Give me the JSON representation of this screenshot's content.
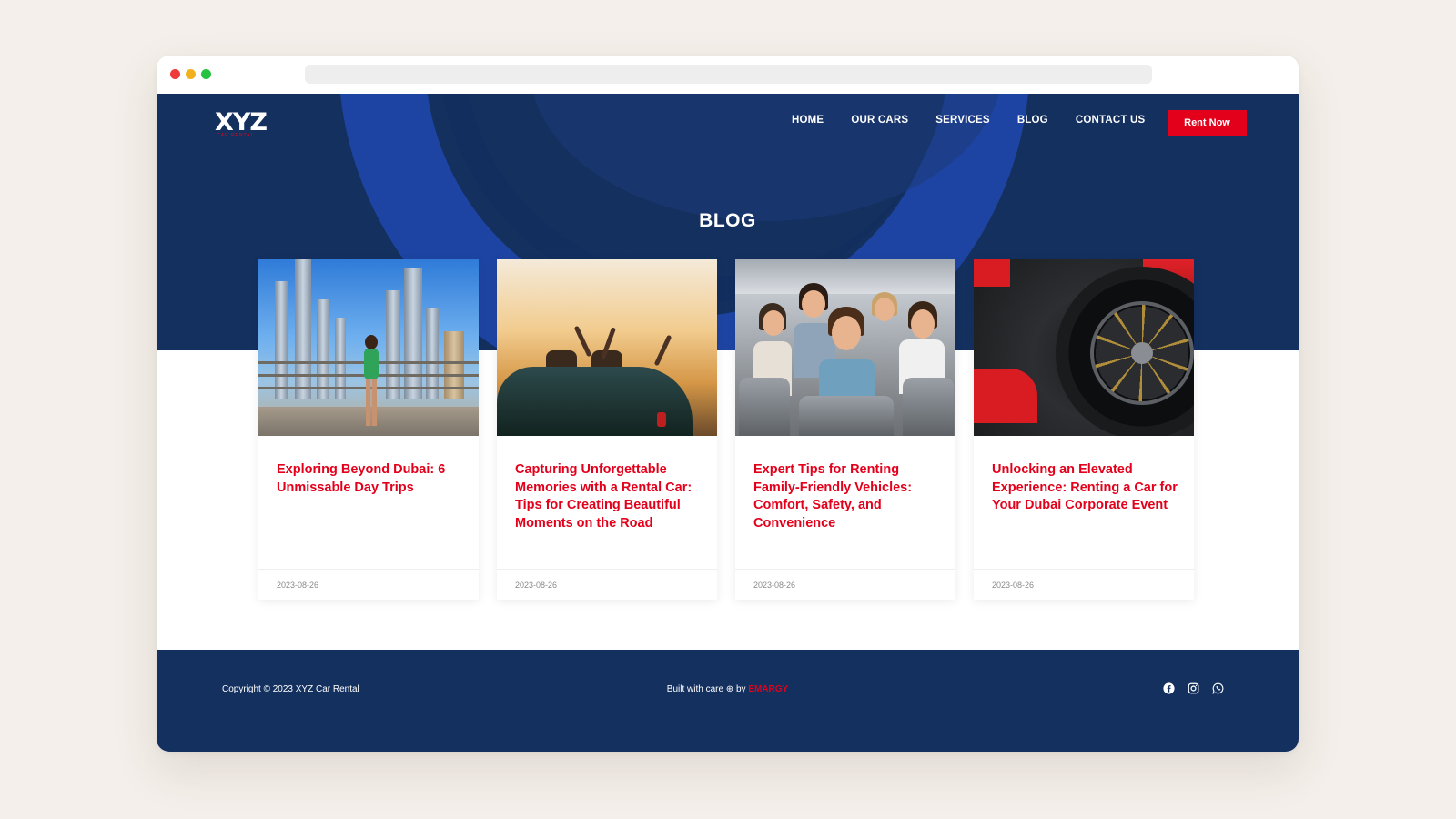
{
  "nav": {
    "logo_text": "XYZ",
    "logo_sub": "CAR RENTAL",
    "items": [
      {
        "label": "HOME"
      },
      {
        "label": "OUR CARS"
      },
      {
        "label": "SERVICES"
      },
      {
        "label": "BLOG"
      },
      {
        "label": "CONTACT US"
      }
    ],
    "cta_label": "Rent Now"
  },
  "page": {
    "title": "BLOG"
  },
  "posts": [
    {
      "title": "Exploring Beyond Dubai: 6 Unmissable Day Trips",
      "date": "2023-08-26",
      "image": "dubai-skyline-photo"
    },
    {
      "title": "Capturing Unforgettable Memories with a Rental Car: Tips for Creating Beautiful Moments on the Road",
      "date": "2023-08-26",
      "image": "convertible-sunset-photo"
    },
    {
      "title": "Expert Tips for Renting Family-Friendly Vehicles: Comfort, Safety, and Convenience",
      "date": "2023-08-26",
      "image": "family-in-car-photo"
    },
    {
      "title": "Unlocking an Elevated Experience: Renting a Car for Your Dubai Corporate Event",
      "date": "2023-08-26",
      "image": "sports-car-wheel-photo"
    }
  ],
  "footer": {
    "copyright": "Copyright © 2023 XYZ Car Rental",
    "built_prefix": "Built with care ⊕ by ",
    "built_brand": "EMARGY",
    "socials": [
      "facebook-icon",
      "instagram-icon",
      "whatsapp-icon"
    ]
  },
  "colors": {
    "navy": "#14305f",
    "accent_red": "#e3001b",
    "arc_blue": "#1f46a6",
    "page_bg": "#f4efea"
  }
}
